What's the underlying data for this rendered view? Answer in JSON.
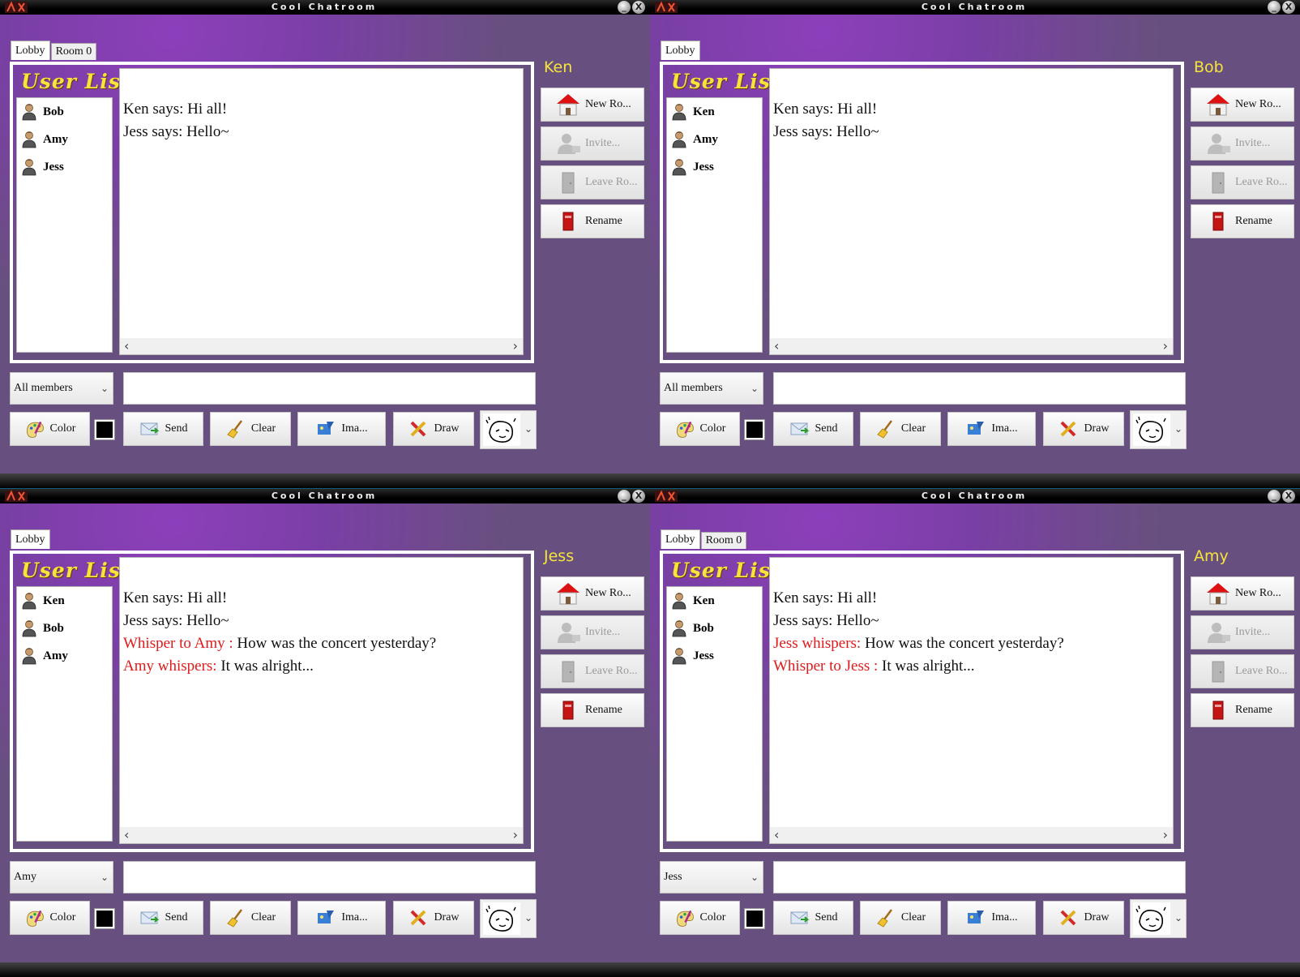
{
  "windows": [
    {
      "title": "Cool Chatroom",
      "tabs": [
        "Lobby",
        "Room 0"
      ],
      "user_list_title": "User List",
      "current_user": "Ken",
      "users": [
        "Bob",
        "Amy",
        "Jess"
      ],
      "messages": [
        {
          "prefix": "",
          "text": "Ken says: Hi all!"
        },
        {
          "prefix": "",
          "text": "Jess says: Hello~"
        }
      ],
      "recipient": "All members",
      "message_input": ""
    },
    {
      "title": "Cool Chatroom",
      "tabs": [
        "Lobby"
      ],
      "user_list_title": "User List",
      "current_user": "Bob",
      "users": [
        "Ken",
        "Amy",
        "Jess"
      ],
      "messages": [
        {
          "prefix": "",
          "text": "Ken says: Hi all!"
        },
        {
          "prefix": "",
          "text": "Jess says: Hello~"
        }
      ],
      "recipient": "All members",
      "message_input": ""
    },
    {
      "title": "Cool Chatroom",
      "tabs": [
        "Lobby"
      ],
      "user_list_title": "User List",
      "current_user": "Jess",
      "users": [
        "Ken",
        "Bob",
        "Amy"
      ],
      "messages": [
        {
          "prefix": "",
          "text": "Ken says: Hi all!"
        },
        {
          "prefix": "",
          "text": "Jess says: Hello~"
        },
        {
          "prefix": "Whisper to Amy : ",
          "text": "How was the concert yesterday?"
        },
        {
          "prefix": "Amy whispers: ",
          "text": "It was alright..."
        }
      ],
      "recipient": "Amy",
      "message_input": ""
    },
    {
      "title": "Cool Chatroom",
      "tabs": [
        "Lobby",
        "Room 0"
      ],
      "user_list_title": "User List",
      "current_user": "Amy",
      "users": [
        "Ken",
        "Bob",
        "Jess"
      ],
      "messages": [
        {
          "prefix": "",
          "text": "Ken says: Hi all!"
        },
        {
          "prefix": "",
          "text": "Jess says: Hello~"
        },
        {
          "prefix": "Jess whispers: ",
          "text": "How was the concert yesterday?"
        },
        {
          "prefix": "Whisper to Jess : ",
          "text": "It was alright..."
        }
      ],
      "recipient": "Jess",
      "message_input": ""
    }
  ],
  "side_buttons": [
    {
      "label": "New Ro...",
      "enabled": true,
      "icon": "house-icon"
    },
    {
      "label": "Invite...",
      "enabled": false,
      "icon": "invite-user-icon"
    },
    {
      "label": "Leave Ro...",
      "enabled": false,
      "icon": "door-icon"
    },
    {
      "label": "Rename",
      "enabled": true,
      "icon": "rename-tag-icon"
    }
  ],
  "bottom_buttons": {
    "color": "Color",
    "send": "Send",
    "clear": "Clear",
    "image": "Ima...",
    "draw": "Draw"
  },
  "colors": {
    "accent_yellow": "#f6e43a",
    "whisper_red": "#e01a1a",
    "background_purple": "#7a3fa6",
    "selected_text_color": "#000000"
  }
}
